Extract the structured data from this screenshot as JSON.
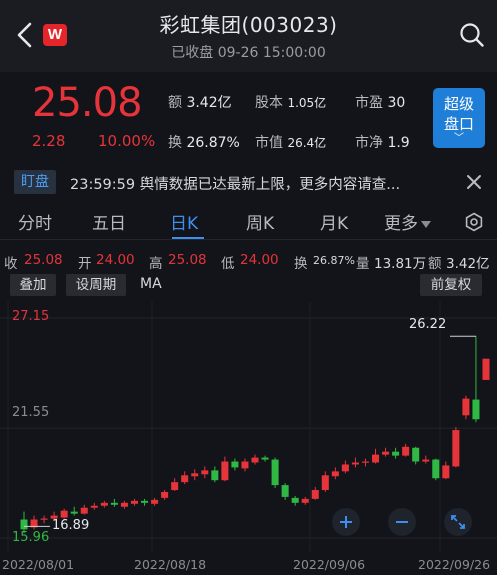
{
  "header": {
    "title": "彩虹集团(003023)",
    "subtitle": "已收盘 09-26 15:00:00",
    "logo_text": "W"
  },
  "quote": {
    "price": "25.08",
    "change": "2.28",
    "change_pct": "10.00%",
    "stats": {
      "amount_label": "额",
      "amount_value": "3.42亿",
      "equity_label": "股本",
      "equity_value": "1.05亿",
      "pe_label": "市盈",
      "pe_value": "30",
      "turnover_label": "换",
      "turnover_value": "26.87%",
      "mcap_label": "市值",
      "mcap_value": "26.4亿",
      "pb_label": "市净",
      "pb_value": "1.9"
    },
    "super_button": {
      "line1": "超级",
      "line2": "盘口",
      "chevron": "﹀"
    }
  },
  "news": {
    "tag": "盯盘",
    "text": "23:59:59 舆情数据已达最新上限，更多内容请查..."
  },
  "tabs": [
    {
      "label": "分时"
    },
    {
      "label": "五日"
    },
    {
      "label": "日K"
    },
    {
      "label": "周K"
    },
    {
      "label": "月K"
    },
    {
      "label": "更多"
    }
  ],
  "ohlc": {
    "close_label": "收",
    "close_value": "25.08",
    "open_label": "开",
    "open_value": "24.00",
    "high_label": "高",
    "high_value": "25.08",
    "low_label": "低",
    "low_value": "24.00",
    "turnover_label": "换",
    "turnover_value": "26.87%",
    "volume_label": "量",
    "volume_value": "13.81万",
    "amount_label": "额",
    "amount_value": "3.42亿"
  },
  "tools": {
    "overlay": "叠加",
    "set_period": "设周期",
    "ma": "MA",
    "adjust": "前复权"
  },
  "colors": {
    "up": "#e5343a",
    "down": "#2fb844",
    "accent": "#3d8ef0",
    "background": "#131419"
  },
  "chart_data": {
    "type": "candlestick",
    "y_ticks": [
      "27.15",
      "21.55",
      "15.96"
    ],
    "ylim": [
      15.96,
      27.15
    ],
    "x_tick_labels": [
      "2022/08/01",
      "2022/08/18",
      "2022/09/06",
      "2022/09/26"
    ],
    "annotations": {
      "high_marker": "26.22",
      "low_marker": "16.89"
    },
    "candles": [
      {
        "o": 16.9,
        "c": 16.4,
        "h": 17.3,
        "l": 16.2
      },
      {
        "o": 16.5,
        "c": 16.9,
        "h": 17.1,
        "l": 16.4
      },
      {
        "o": 16.9,
        "c": 16.95,
        "h": 17.1,
        "l": 16.7
      },
      {
        "o": 16.95,
        "c": 17.1,
        "h": 17.3,
        "l": 16.85
      },
      {
        "o": 17.0,
        "c": 17.35,
        "h": 17.45,
        "l": 16.95
      },
      {
        "o": 17.3,
        "c": 17.2,
        "h": 17.55,
        "l": 17.1
      },
      {
        "o": 17.2,
        "c": 17.5,
        "h": 17.65,
        "l": 17.15
      },
      {
        "o": 17.5,
        "c": 17.6,
        "h": 17.75,
        "l": 17.4
      },
      {
        "o": 17.6,
        "c": 17.75,
        "h": 17.85,
        "l": 17.5
      },
      {
        "o": 17.75,
        "c": 17.65,
        "h": 17.95,
        "l": 17.55
      },
      {
        "o": 17.55,
        "c": 17.75,
        "h": 17.85,
        "l": 17.45
      },
      {
        "o": 17.7,
        "c": 17.85,
        "h": 17.95,
        "l": 17.6
      },
      {
        "o": 17.85,
        "c": 17.75,
        "h": 17.95,
        "l": 17.6
      },
      {
        "o": 17.7,
        "c": 17.9,
        "h": 18.0,
        "l": 17.6
      },
      {
        "o": 18.0,
        "c": 18.3,
        "h": 18.4,
        "l": 17.9
      },
      {
        "o": 18.4,
        "c": 18.8,
        "h": 19.0,
        "l": 18.35
      },
      {
        "o": 18.8,
        "c": 19.15,
        "h": 19.35,
        "l": 18.7
      },
      {
        "o": 19.1,
        "c": 19.25,
        "h": 19.45,
        "l": 18.9
      },
      {
        "o": 19.2,
        "c": 19.4,
        "h": 19.6,
        "l": 19.0
      },
      {
        "o": 19.4,
        "c": 18.9,
        "h": 19.6,
        "l": 18.8
      },
      {
        "o": 18.9,
        "c": 19.85,
        "h": 20.1,
        "l": 18.85
      },
      {
        "o": 19.85,
        "c": 19.55,
        "h": 20.0,
        "l": 19.4
      },
      {
        "o": 19.5,
        "c": 19.85,
        "h": 20.0,
        "l": 19.35
      },
      {
        "o": 19.8,
        "c": 20.05,
        "h": 20.2,
        "l": 19.7
      },
      {
        "o": 20.05,
        "c": 19.95,
        "h": 20.15,
        "l": 19.85
      },
      {
        "o": 19.95,
        "c": 18.65,
        "h": 20.05,
        "l": 18.5
      },
      {
        "o": 18.65,
        "c": 18.05,
        "h": 18.75,
        "l": 17.9
      },
      {
        "o": 18.0,
        "c": 17.75,
        "h": 18.1,
        "l": 17.6
      },
      {
        "o": 17.75,
        "c": 17.95,
        "h": 18.05,
        "l": 17.65
      },
      {
        "o": 17.95,
        "c": 18.4,
        "h": 18.55,
        "l": 17.9
      },
      {
        "o": 18.4,
        "c": 19.15,
        "h": 19.35,
        "l": 18.3
      },
      {
        "o": 19.1,
        "c": 19.35,
        "h": 19.55,
        "l": 18.95
      },
      {
        "o": 19.35,
        "c": 19.7,
        "h": 19.9,
        "l": 19.25
      },
      {
        "o": 19.7,
        "c": 19.8,
        "h": 20.05,
        "l": 19.55
      },
      {
        "o": 19.8,
        "c": 19.85,
        "h": 20.0,
        "l": 19.6
      },
      {
        "o": 19.8,
        "c": 20.2,
        "h": 20.5,
        "l": 19.75
      },
      {
        "o": 20.2,
        "c": 20.35,
        "h": 20.55,
        "l": 20.1
      },
      {
        "o": 20.35,
        "c": 20.15,
        "h": 20.55,
        "l": 20.0
      },
      {
        "o": 20.15,
        "c": 20.6,
        "h": 20.75,
        "l": 20.1
      },
      {
        "o": 20.55,
        "c": 19.85,
        "h": 20.6,
        "l": 19.7
      },
      {
        "o": 19.85,
        "c": 19.95,
        "h": 20.15,
        "l": 19.75
      },
      {
        "o": 19.95,
        "c": 19.0,
        "h": 20.0,
        "l": 18.9
      },
      {
        "o": 19.0,
        "c": 19.65,
        "h": 19.85,
        "l": 18.95
      },
      {
        "o": 19.6,
        "c": 21.45,
        "h": 21.6,
        "l": 19.55
      },
      {
        "o": 22.2,
        "c": 23.05,
        "h": 23.2,
        "l": 22.0
      },
      {
        "o": 23.0,
        "c": 22.0,
        "h": 26.22,
        "l": 21.85
      },
      {
        "o": 24.0,
        "c": 25.08,
        "h": 25.08,
        "l": 24.0
      }
    ]
  }
}
